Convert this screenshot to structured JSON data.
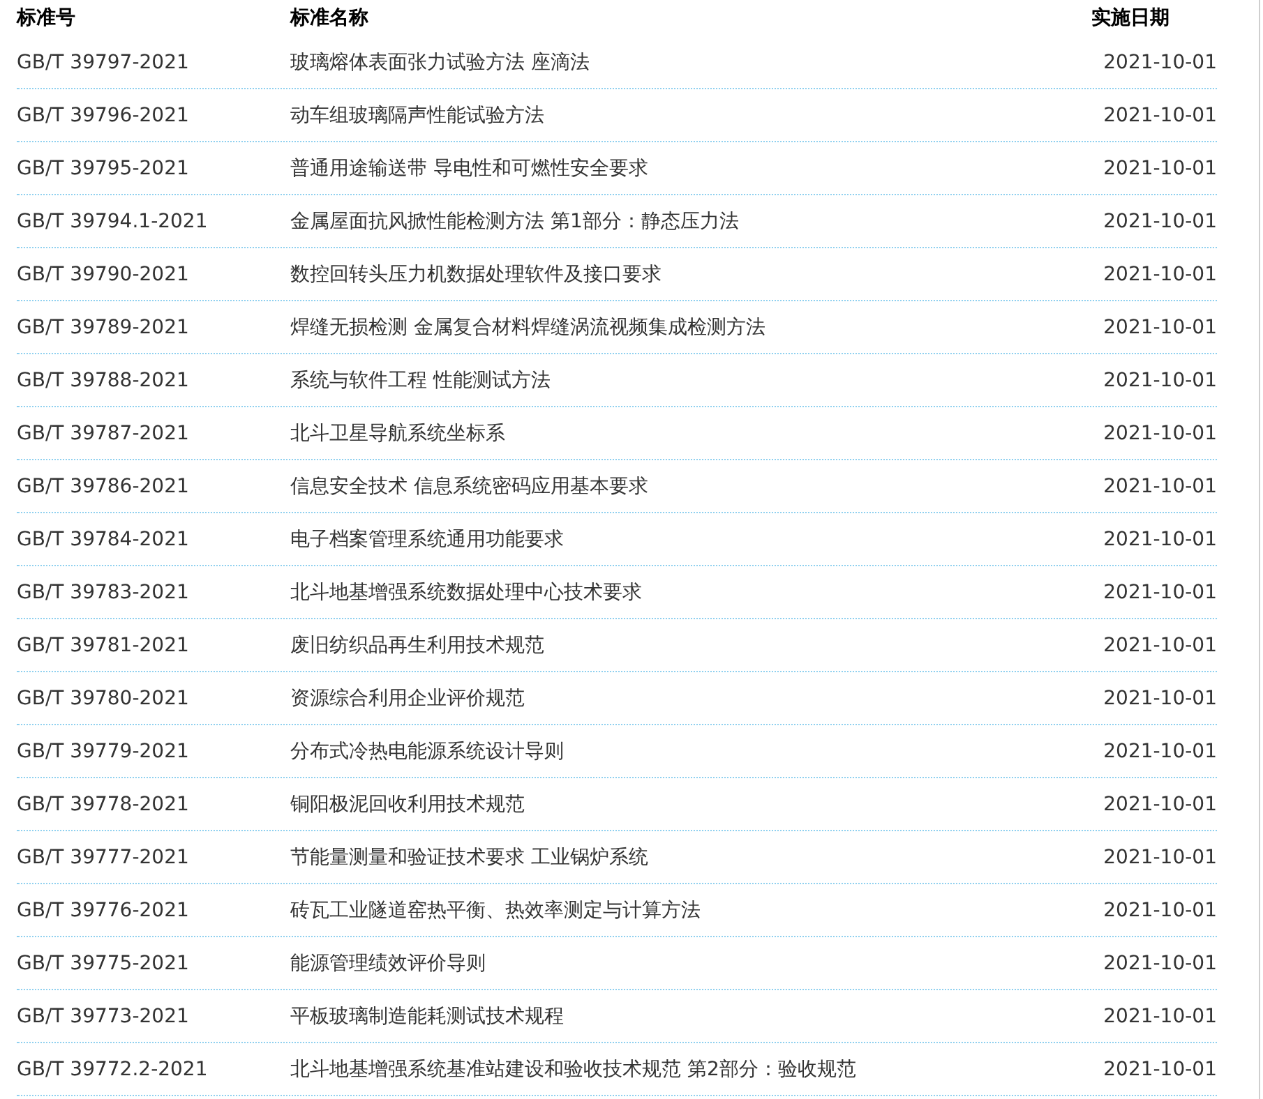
{
  "table": {
    "columns": [
      "标准号",
      "标准名称",
      "实施日期"
    ],
    "rows": [
      {
        "code": "GB/T 39797-2021",
        "name": "玻璃熔体表面张力试验方法 座滴法",
        "date": "2021-10-01"
      },
      {
        "code": "GB/T 39796-2021",
        "name": "动车组玻璃隔声性能试验方法",
        "date": "2021-10-01"
      },
      {
        "code": "GB/T 39795-2021",
        "name": "普通用途输送带 导电性和可燃性安全要求",
        "date": "2021-10-01"
      },
      {
        "code": "GB/T 39794.1-2021",
        "name": "金属屋面抗风掀性能检测方法 第1部分：静态压力法",
        "date": "2021-10-01"
      },
      {
        "code": "GB/T 39790-2021",
        "name": "数控回转头压力机数据处理软件及接口要求",
        "date": "2021-10-01"
      },
      {
        "code": "GB/T 39789-2021",
        "name": "焊缝无损检测 金属复合材料焊缝涡流视频集成检测方法",
        "date": "2021-10-01"
      },
      {
        "code": "GB/T 39788-2021",
        "name": "系统与软件工程 性能测试方法",
        "date": "2021-10-01"
      },
      {
        "code": "GB/T 39787-2021",
        "name": "北斗卫星导航系统坐标系",
        "date": "2021-10-01"
      },
      {
        "code": "GB/T 39786-2021",
        "name": "信息安全技术 信息系统密码应用基本要求",
        "date": "2021-10-01"
      },
      {
        "code": "GB/T 39784-2021",
        "name": "电子档案管理系统通用功能要求",
        "date": "2021-10-01"
      },
      {
        "code": "GB/T 39783-2021",
        "name": "北斗地基增强系统数据处理中心技术要求",
        "date": "2021-10-01"
      },
      {
        "code": "GB/T 39781-2021",
        "name": "废旧纺织品再生利用技术规范",
        "date": "2021-10-01"
      },
      {
        "code": "GB/T 39780-2021",
        "name": "资源综合利用企业评价规范",
        "date": "2021-10-01"
      },
      {
        "code": "GB/T 39779-2021",
        "name": "分布式冷热电能源系统设计导则",
        "date": "2021-10-01"
      },
      {
        "code": "GB/T 39778-2021",
        "name": "铜阳极泥回收利用技术规范",
        "date": "2021-10-01"
      },
      {
        "code": "GB/T 39777-2021",
        "name": "节能量测量和验证技术要求 工业锅炉系统",
        "date": "2021-10-01"
      },
      {
        "code": "GB/T 39776-2021",
        "name": "砖瓦工业隧道窑热平衡、热效率测定与计算方法",
        "date": "2021-10-01"
      },
      {
        "code": "GB/T 39775-2021",
        "name": "能源管理绩效评价导则",
        "date": "2021-10-01"
      },
      {
        "code": "GB/T 39773-2021",
        "name": "平板玻璃制造能耗测试技术规程",
        "date": "2021-10-01"
      },
      {
        "code": "GB/T 39772.2-2021",
        "name": "北斗地基增强系统基准站建设和验收技术规范 第2部分：验收规范",
        "date": "2021-10-01"
      }
    ]
  }
}
